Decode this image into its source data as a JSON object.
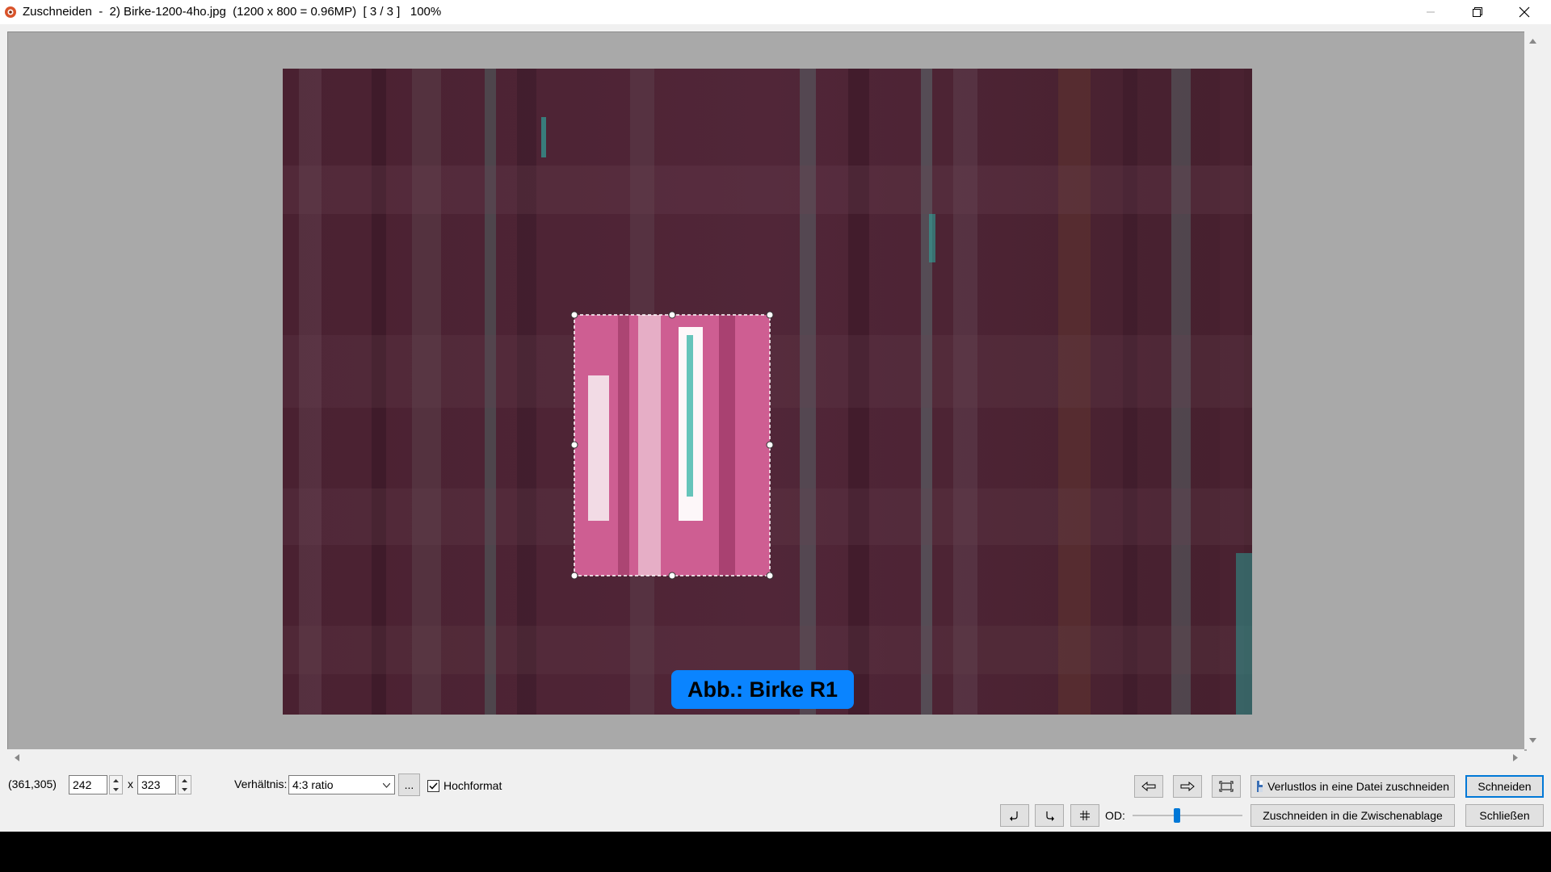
{
  "titlebar": {
    "title": "Zuschneiden  -  2) Birke-1200-4ho.jpg  (1200 x 800 = 0.96MP)  [ 3 / 3 ]   100%",
    "icon": "irfanview-app-icon",
    "minimize_icon": "minimize-icon",
    "restore_icon": "restore-icon",
    "close_icon": "close-icon"
  },
  "image": {
    "caption": "Abb.: Birke R1",
    "caption_color": "#0a84ff",
    "tint": "#4a1f33"
  },
  "controls": {
    "position": "(361,305)",
    "width_value": "242",
    "times": "x",
    "height_value": "323",
    "ratio_label": "Verhältnis:",
    "ratio_value": "4:3 ratio",
    "more_button": "...",
    "portrait_label": "Hochformat",
    "portrait_checked": true,
    "prev_icon": "arrow-left-icon",
    "next_icon": "arrow-right-icon",
    "fit_icon": "fit-crop-icon",
    "lossless_button": "Verlustlos in eine Datei zuschneiden",
    "cut_button": "Schneiden",
    "rotate_left_icon": "rotate-left-icon",
    "rotate_right_icon": "rotate-right-icon",
    "grid_icon": "grid-icon",
    "od_label": "OD:",
    "od_level": 0.4,
    "clipboard_button": "Zuschneiden in die Zwischenablage",
    "close_button": "Schließen"
  }
}
